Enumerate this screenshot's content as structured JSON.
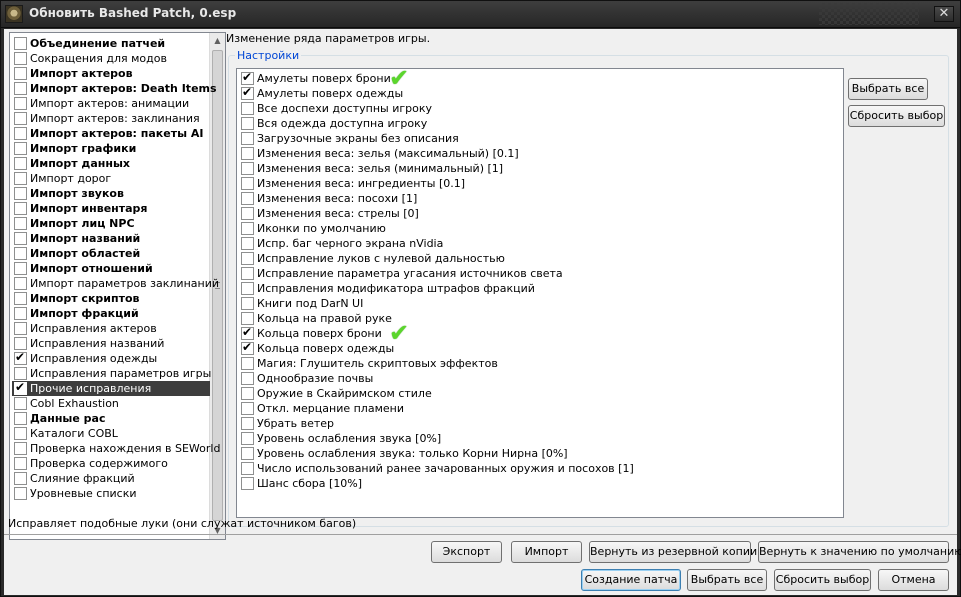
{
  "window": {
    "title": "Обновить Bashed Patch, 0.esp",
    "close_glyph": "✕"
  },
  "patchers": [
    {
      "label": "Объединение патчей",
      "bold": true,
      "checked": false
    },
    {
      "label": "Сокращения для модов",
      "bold": false,
      "checked": false
    },
    {
      "label": "Импорт актеров",
      "bold": true,
      "checked": false
    },
    {
      "label": "Импорт актеров: Death Items",
      "bold": true,
      "checked": false
    },
    {
      "label": "Импорт актеров: анимации",
      "bold": false,
      "checked": false
    },
    {
      "label": "Импорт актеров: заклинания",
      "bold": false,
      "checked": false
    },
    {
      "label": "Импорт актеров: пакеты AI",
      "bold": true,
      "checked": false
    },
    {
      "label": "Импорт графики",
      "bold": true,
      "checked": false
    },
    {
      "label": "Импорт данных",
      "bold": true,
      "checked": false
    },
    {
      "label": "Импорт дорог",
      "bold": false,
      "checked": false
    },
    {
      "label": "Импорт звуков",
      "bold": true,
      "checked": false
    },
    {
      "label": "Импорт инвентаря",
      "bold": true,
      "checked": false
    },
    {
      "label": "Импорт лиц NPC",
      "bold": true,
      "checked": false
    },
    {
      "label": "Импорт названий",
      "bold": true,
      "checked": false
    },
    {
      "label": "Импорт областей",
      "bold": true,
      "checked": false
    },
    {
      "label": "Импорт отношений",
      "bold": true,
      "checked": false
    },
    {
      "label": "Импорт параметров заклинаний",
      "bold": false,
      "checked": false
    },
    {
      "label": "Импорт скриптов",
      "bold": true,
      "checked": false
    },
    {
      "label": "Импорт фракций",
      "bold": true,
      "checked": false
    },
    {
      "label": "Исправления актеров",
      "bold": false,
      "checked": false
    },
    {
      "label": "Исправления названий",
      "bold": false,
      "checked": false
    },
    {
      "label": "Исправления одежды",
      "bold": false,
      "checked": true
    },
    {
      "label": "Исправления параметров игры",
      "bold": false,
      "checked": false
    },
    {
      "label": "Прочие исправления",
      "bold": false,
      "checked": true,
      "selected": true
    },
    {
      "label": "Cobl Exhaustion",
      "bold": false,
      "checked": false
    },
    {
      "label": "Данные рас",
      "bold": true,
      "checked": false
    },
    {
      "label": "Каталоги COBL",
      "bold": false,
      "checked": false
    },
    {
      "label": "Проверка нахождения в SEWorld",
      "bold": false,
      "checked": false
    },
    {
      "label": "Проверка содержимого",
      "bold": false,
      "checked": false
    },
    {
      "label": "Слияние фракций",
      "bold": false,
      "checked": false
    },
    {
      "label": "Уровневые списки",
      "bold": false,
      "checked": false
    }
  ],
  "right": {
    "description": "Изменение ряда параметров игры.",
    "group_title": "Настройки",
    "select_all": "Выбрать все",
    "deselect": "Сбросить выбор",
    "green_check_glyph": "✔",
    "options": [
      {
        "label": "Амулеты поверх брони",
        "checked": true,
        "mark": true
      },
      {
        "label": "Амулеты поверх одежды",
        "checked": true
      },
      {
        "label": "Все доспехи доступны игроку",
        "checked": false
      },
      {
        "label": "Вся одежда доступна игроку",
        "checked": false
      },
      {
        "label": "Загрузочные экраны без описания",
        "checked": false
      },
      {
        "label": "Изменения веса: зелья (максимальный) [0.1]",
        "checked": false
      },
      {
        "label": "Изменения веса: зелья (минимальный) [1]",
        "checked": false
      },
      {
        "label": "Изменения веса: ингредиенты [0.1]",
        "checked": false
      },
      {
        "label": "Изменения веса: посохи [1]",
        "checked": false
      },
      {
        "label": "Изменения веса: стрелы [0]",
        "checked": false
      },
      {
        "label": "Иконки по умолчанию",
        "checked": false
      },
      {
        "label": "Испр. баг черного экрана nVidia",
        "checked": false
      },
      {
        "label": "Исправление луков с нулевой дальностью",
        "checked": false
      },
      {
        "label": "Исправление параметра угасания источников света",
        "checked": false
      },
      {
        "label": "Исправления модификатора штрафов фракций",
        "checked": false
      },
      {
        "label": "Книги под DarN UI",
        "checked": false
      },
      {
        "label": "Кольца на правой руке",
        "checked": false
      },
      {
        "label": "Кольца поверх брони",
        "checked": true,
        "mark": true
      },
      {
        "label": "Кольца поверх одежды",
        "checked": true
      },
      {
        "label": "Магия: Глушитель скриптовых эффектов",
        "checked": false
      },
      {
        "label": "Однообразие почвы",
        "checked": false
      },
      {
        "label": "Оружие в Скайримском стиле",
        "checked": false
      },
      {
        "label": "Откл. мерцание пламени",
        "checked": false
      },
      {
        "label": "Убрать ветер",
        "checked": false
      },
      {
        "label": "Уровень ослабления звука [0%]",
        "checked": false
      },
      {
        "label": "Уровень ослабления звука: только Корни Нирна [0%]",
        "checked": false
      },
      {
        "label": "Число использований ранее зачарованных оружия и посохов [1]",
        "checked": false
      },
      {
        "label": "Шанс сбора [10%]",
        "checked": false
      }
    ]
  },
  "status_text": "Исправляет подобные луки (они служат источником багов)",
  "bottom": {
    "export": "Экспорт",
    "import": "Импорт",
    "restore_backup": "Вернуть из резервной копии",
    "restore_default": "Вернуть к значению по умолчанию",
    "build_patch": "Создание патча",
    "select_all": "Выбрать все",
    "deselect": "Сбросить выбор",
    "cancel": "Отмена"
  },
  "scroll_glyphs": {
    "up": "▲",
    "down": "▼"
  }
}
